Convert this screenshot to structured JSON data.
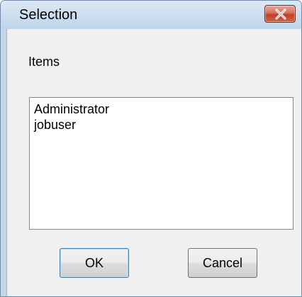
{
  "window": {
    "title": "Selection"
  },
  "group": {
    "label": "Items"
  },
  "list": {
    "items": [
      "Administrator",
      "jobuser"
    ]
  },
  "buttons": {
    "ok_label": "OK",
    "cancel_label": "Cancel"
  },
  "icons": {
    "close": "close-icon"
  },
  "colors": {
    "close_button": "#c2402a",
    "titlebar": "#cfdff0",
    "client_background": "#f0f0f0",
    "default_button_border": "#3c7fb1"
  }
}
